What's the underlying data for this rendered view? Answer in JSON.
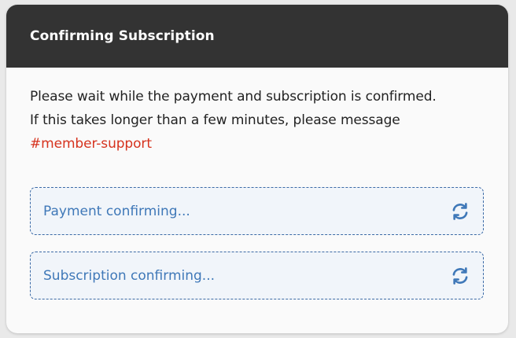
{
  "dialog": {
    "title": "Confirming Subscription",
    "message_line1": "Please wait while the payment and subscription is confirmed.",
    "message_line2": "If this takes longer than a few minutes, please message",
    "support_link": "#member-support"
  },
  "statuses": [
    {
      "label": "Payment confirming...",
      "icon": "refresh-icon"
    },
    {
      "label": "Subscription confirming...",
      "icon": "refresh-icon"
    }
  ],
  "colors": {
    "header_bg": "#333333",
    "link": "#d6321d",
    "status_text": "#3f78b8",
    "status_border": "#3b6aa6"
  }
}
